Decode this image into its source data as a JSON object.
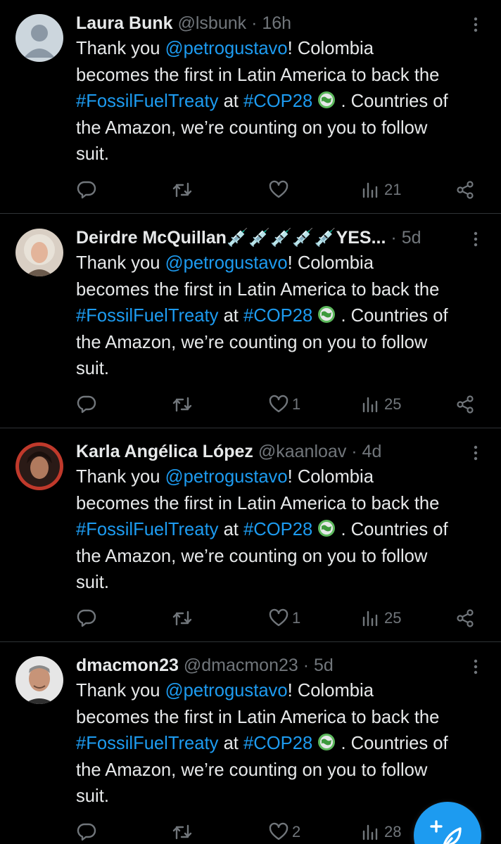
{
  "tweets": [
    {
      "name": "Laura Bunk",
      "handle": "@lsbunk",
      "time": "16h",
      "body": {
        "l1a": "Thank you ",
        "mention": "@petrogustavo",
        "l1b": "! Colombia",
        "l2": "becomes the first in Latin America to back the",
        "hashtag1": "#FossilFuelTreaty",
        "at": " at ",
        "hashtag2": "#COP28",
        "l3b": " . Countries of",
        "l4": "the Amazon, we’re counting on you to follow",
        "l5": "suit."
      },
      "likes": "",
      "views": "21"
    },
    {
      "name": "Deirdre McQuillan💉💉💉💉💉YES...",
      "handle": "",
      "time": "5d",
      "body": {
        "l1a": "Thank you ",
        "mention": "@petrogustavo",
        "l1b": "! Colombia",
        "l2": "becomes the first in Latin America to back the",
        "hashtag1": "#FossilFuelTreaty",
        "at": " at ",
        "hashtag2": "#COP28",
        "l3b": " . Countries of",
        "l4": "the Amazon, we’re counting on you to follow",
        "l5": "suit."
      },
      "likes": "1",
      "views": "25"
    },
    {
      "name": "Karla Angélica López",
      "handle": "@kaanloav",
      "time": "4d",
      "body": {
        "l1a": "Thank you ",
        "mention": "@petrogustavo",
        "l1b": "! Colombia",
        "l2": "becomes the first in Latin America to back the",
        "hashtag1": "#FossilFuelTreaty",
        "at": " at ",
        "hashtag2": "#COP28",
        "l3b": " . Countries of",
        "l4": "the Amazon, we’re counting on you to follow",
        "l5": "suit."
      },
      "likes": "1",
      "views": "25"
    },
    {
      "name": "dmacmon23",
      "handle": "@dmacmon23",
      "time": "5d",
      "body": {
        "l1a": "Thank you ",
        "mention": "@petrogustavo",
        "l1b": "! Colombia",
        "l2": "becomes the first in Latin America to back the",
        "hashtag1": "#FossilFuelTreaty",
        "at": " at ",
        "hashtag2": "#COP28",
        "l3b": " . Countries of",
        "l4": "the Amazon, we’re counting on you to follow",
        "l5": "suit."
      },
      "likes": "2",
      "views": "28"
    }
  ],
  "separator": " · ",
  "colors": {
    "background": "#000000",
    "text": "#e7e9ea",
    "muted": "#71767b",
    "link": "#1d9bf0",
    "divider": "#2f3336"
  },
  "icons": {
    "reply": "reply-icon",
    "repost": "repost-icon",
    "like": "heart-icon",
    "views": "views-icon",
    "share": "share-icon",
    "more": "more-icon",
    "compose": "compose-icon"
  }
}
